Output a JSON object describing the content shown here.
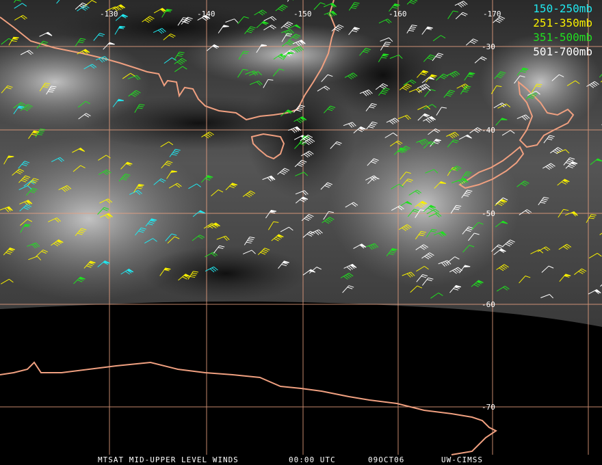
{
  "map": {
    "lon_labels": [
      "-130",
      "-140",
      "-150",
      "-160",
      "-170"
    ],
    "lat_labels": [
      "-30",
      "-40",
      "-50",
      "-60",
      "-70"
    ],
    "grid_color": "#e8a080",
    "coast_color": "#f0a080"
  },
  "legend": [
    {
      "label": "150-250mb",
      "color": "#20e8f0"
    },
    {
      "label": "251-350mb",
      "color": "#f8f000"
    },
    {
      "label": "351-500mb",
      "color": "#20e020"
    },
    {
      "label": "501-700mb",
      "color": "#ffffff"
    }
  ],
  "footer": {
    "product": "MTSAT MID-UPPER LEVEL WINDS",
    "time": "00:00 UTC",
    "date": "09OCT06",
    "source": "UW-CIMSS"
  }
}
